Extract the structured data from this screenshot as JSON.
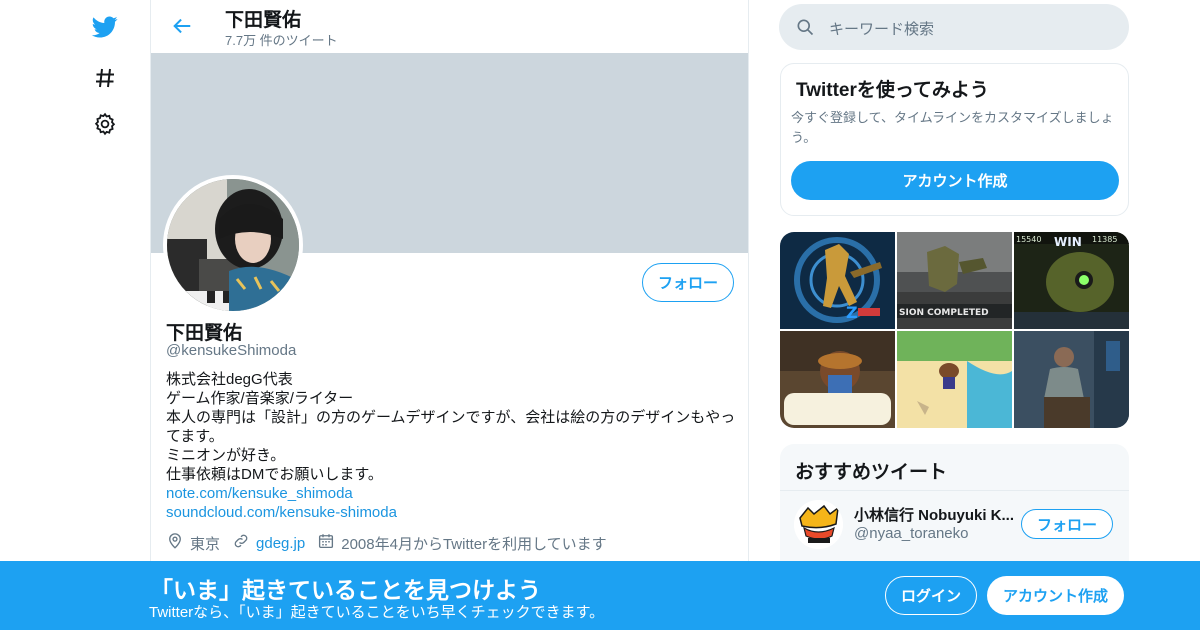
{
  "nav": {
    "logo_icon": "twitter-bird-icon",
    "explore_icon": "hashtag-icon",
    "settings_icon": "gear-icon"
  },
  "colors": {
    "accent": "#1da1f2",
    "banner": "#ccd6dd",
    "secondary_text": "#657786"
  },
  "header": {
    "title": "下田賢佑",
    "tweet_count": "7.7万 件のツイート"
  },
  "profile": {
    "follow_label": "フォロー",
    "name": "下田賢佑",
    "handle": "@kensukeShimoda",
    "bio_lines": [
      "株式会社degG代表",
      "ゲーム作家/音楽家/ライター",
      "本人の専門は「設計」の方のゲームデザインですが、会社は絵の方のデザインもやってます。",
      "ミニオンが好き。",
      "仕事依頼はDMでお願いします。"
    ],
    "bio_links": [
      "note.com/kensuke_shimoda",
      "soundcloud.com/kensuke-shimoda"
    ],
    "location": "東京",
    "website": "gdeg.jp",
    "joined": "2008年4月からTwitterを利用しています"
  },
  "search": {
    "placeholder": "キーワード検索"
  },
  "signup_card": {
    "title": "Twitterを使ってみよう",
    "description": "今すぐ登録して、タイムラインをカスタマイズしましょう。",
    "button": "アカウント作成"
  },
  "media": {
    "game_labels": [
      "SION COMPLETED",
      "WIN",
      "15540",
      "11385"
    ]
  },
  "recommended": {
    "title": "おすすめツイート",
    "name": "小林信行 Nobuyuki K...",
    "handle": "@nyaa_toraneko",
    "follow_label": "フォロー"
  },
  "bottom_bar": {
    "title": "「いま」起きていることを見つけよう",
    "subtitle": "Twitterなら、「いま」起きていることをいち早くチェックできます。",
    "login": "ログイン",
    "signup": "アカウント作成"
  }
}
